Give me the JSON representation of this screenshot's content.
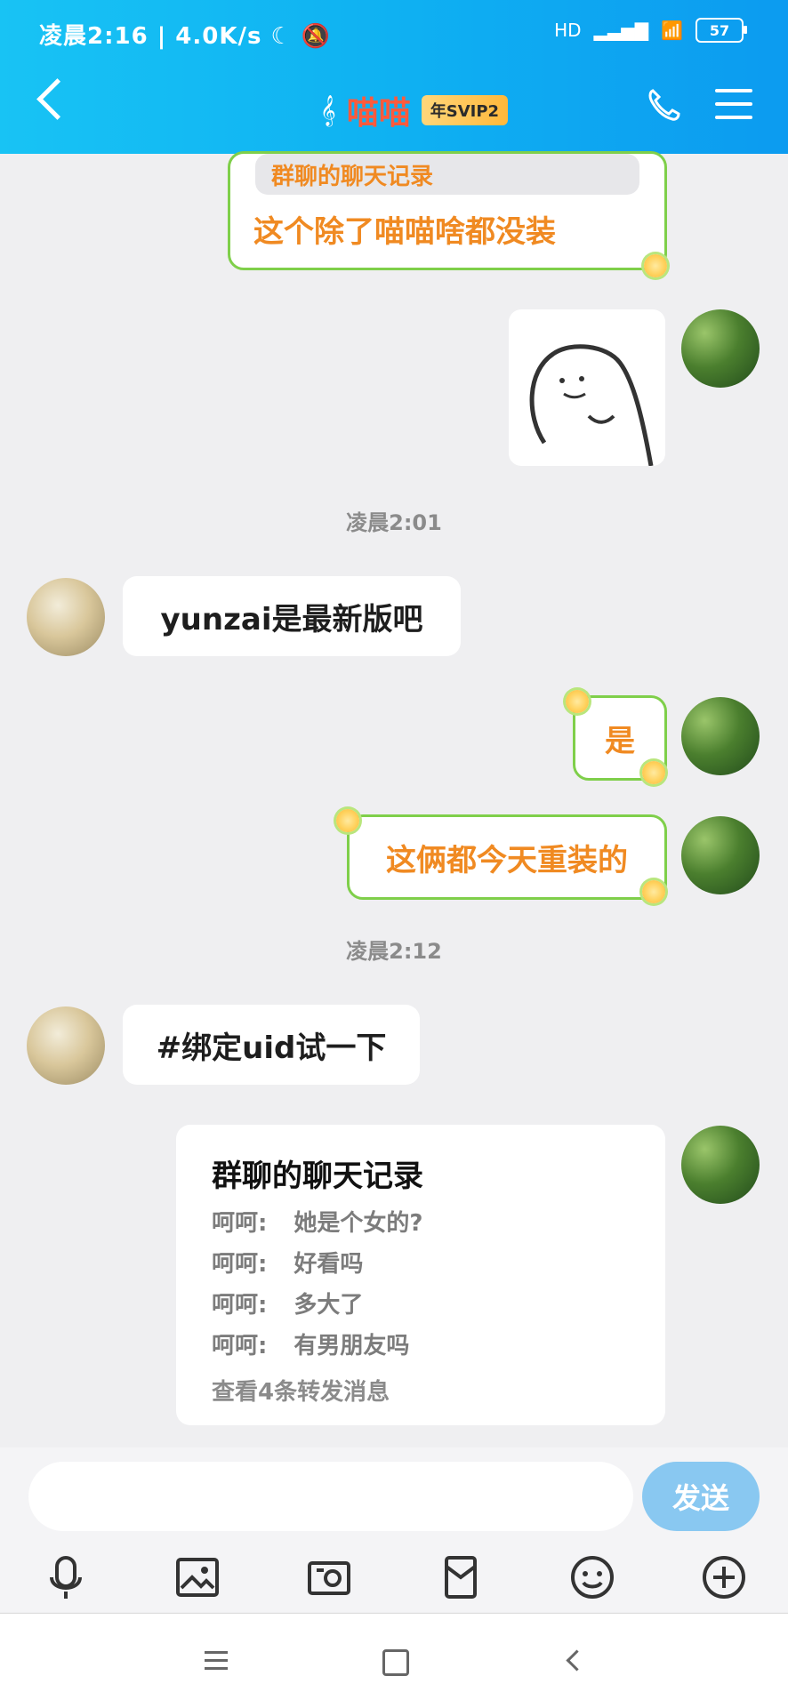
{
  "status": {
    "time": "凌晨2:16",
    "speed": "4.0K/s",
    "network": "HD",
    "battery": "57"
  },
  "header": {
    "title": "喵喵",
    "badge": "年SVIP2"
  },
  "messages": {
    "top_quote_label": "群聊的聊天记录",
    "top_text": "这个除了喵喵啥都没装",
    "time1": "凌晨2:01",
    "other_msg1": "yunzai是最新版吧",
    "me_msg1": "是",
    "me_msg2": "这俩都今天重装的",
    "time2": "凌晨2:12",
    "other_msg2": "#绑定uid试一下"
  },
  "forward": {
    "title": "群聊的聊天记录",
    "lines": [
      {
        "name": "呵呵:",
        "text": "她是个女的?"
      },
      {
        "name": "呵呵:",
        "text": "好看吗"
      },
      {
        "name": "呵呵:",
        "text": "多大了"
      },
      {
        "name": "呵呵:",
        "text": "有男朋友吗"
      }
    ],
    "footer": "查看4条转发消息"
  },
  "input": {
    "placeholder": "",
    "send": "发送"
  },
  "icons": {
    "mic": "microphone-icon",
    "image": "image-icon",
    "camera": "camera-icon",
    "redpacket": "red-packet-icon",
    "emoji": "emoji-icon",
    "plus": "plus-icon"
  }
}
